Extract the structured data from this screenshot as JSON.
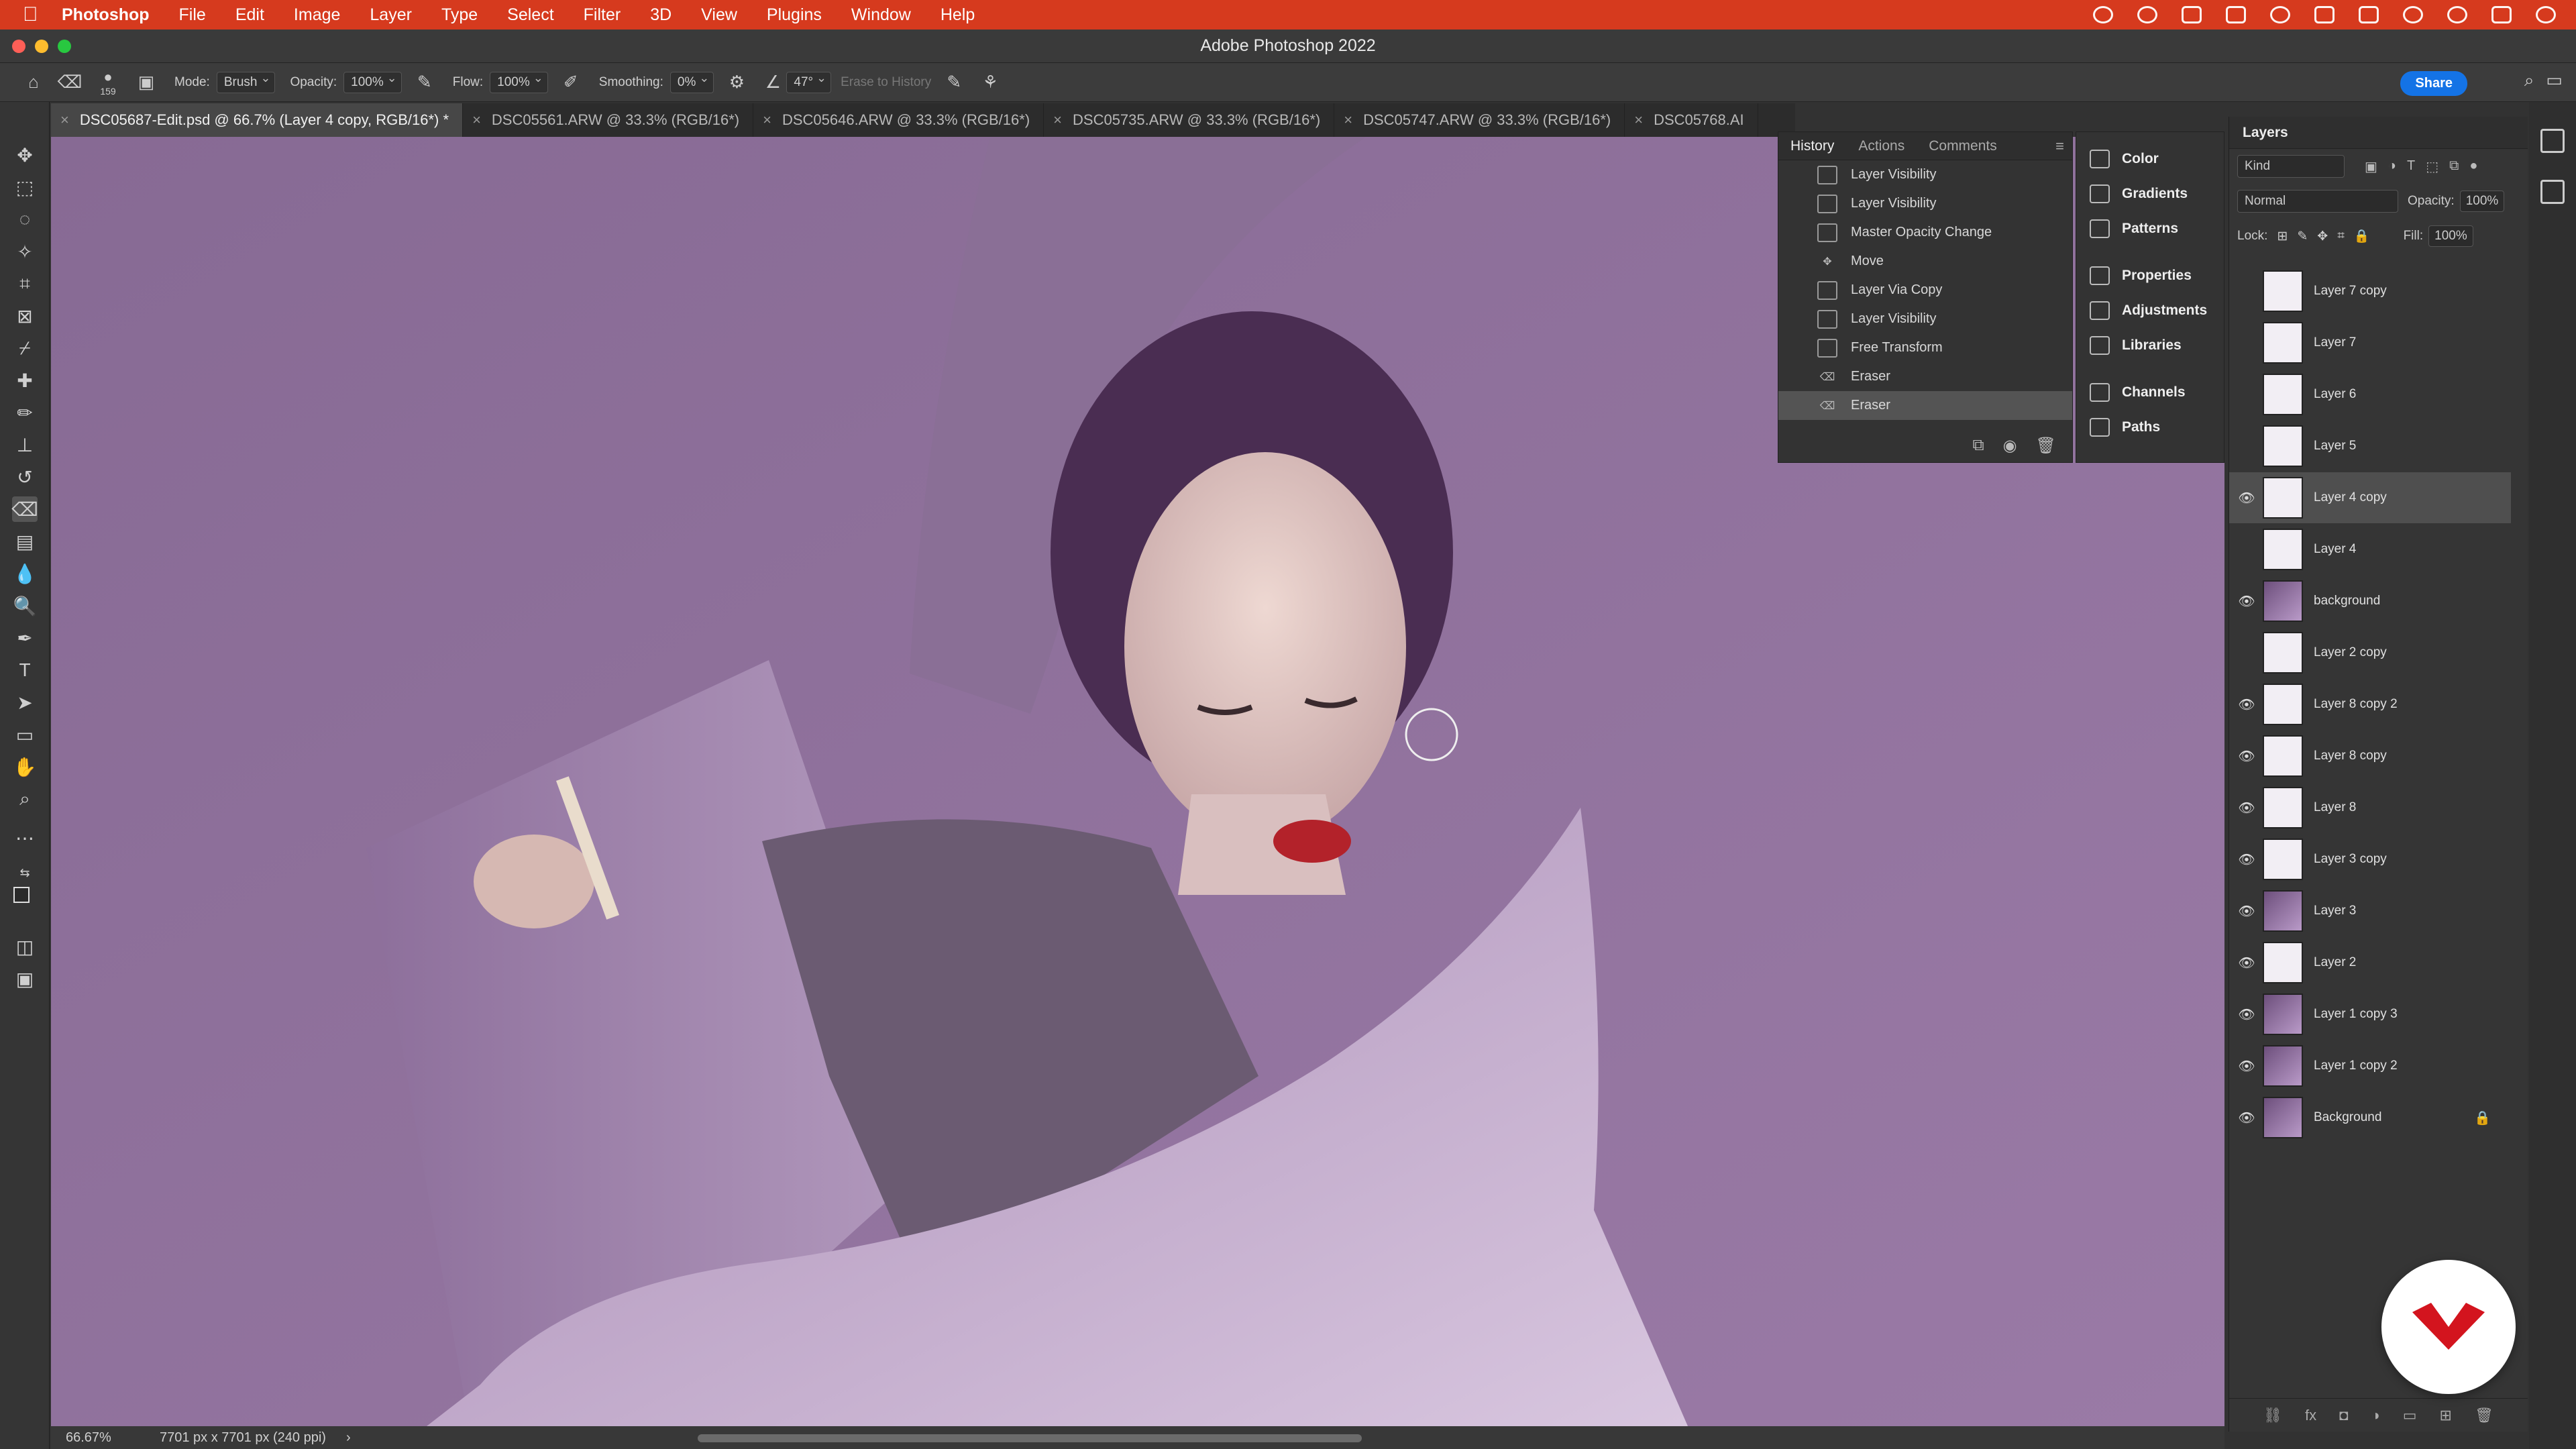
{
  "menubar": {
    "app": "Photoshop",
    "items": [
      "File",
      "Edit",
      "Image",
      "Layer",
      "Type",
      "Select",
      "Filter",
      "3D",
      "View",
      "Plugins",
      "Window",
      "Help"
    ]
  },
  "window": {
    "title": "Adobe Photoshop 2022"
  },
  "options": {
    "brush_size": "159",
    "mode_label": "Mode:",
    "mode_value": "Brush",
    "opacity_label": "Opacity:",
    "opacity_value": "100%",
    "flow_label": "Flow:",
    "flow_value": "100%",
    "smoothing_label": "Smoothing:",
    "smoothing_value": "0%",
    "angle_value": "47°",
    "erase_to_history": "Erase to History",
    "share_label": "Share"
  },
  "tabs": [
    {
      "label": "DSC05687-Edit.psd @ 66.7% (Layer 4 copy, RGB/16*) *",
      "active": true
    },
    {
      "label": "DSC05561.ARW @ 33.3% (RGB/16*)",
      "active": false
    },
    {
      "label": "DSC05646.ARW @ 33.3% (RGB/16*)",
      "active": false
    },
    {
      "label": "DSC05735.ARW @ 33.3% (RGB/16*)",
      "active": false
    },
    {
      "label": "DSC05747.ARW @ 33.3% (RGB/16*)",
      "active": false
    },
    {
      "label": "DSC05768.AI",
      "active": false
    }
  ],
  "history": {
    "tabs": [
      "History",
      "Actions",
      "Comments"
    ],
    "items": [
      {
        "label": "Layer Visibility",
        "icon": "doc-icon"
      },
      {
        "label": "Layer Visibility",
        "icon": "doc-icon"
      },
      {
        "label": "Master Opacity Change",
        "icon": "doc-icon"
      },
      {
        "label": "Move",
        "icon": "move-icon"
      },
      {
        "label": "Layer Via Copy",
        "icon": "doc-icon"
      },
      {
        "label": "Layer Visibility",
        "icon": "doc-icon"
      },
      {
        "label": "Free Transform",
        "icon": "doc-icon"
      },
      {
        "label": "Eraser",
        "icon": "eraser-icon"
      },
      {
        "label": "Eraser",
        "icon": "eraser-icon",
        "selected": true
      }
    ]
  },
  "dock": {
    "group1": [
      "Color",
      "Gradients",
      "Patterns"
    ],
    "group2": [
      "Properties",
      "Adjustments",
      "Libraries"
    ],
    "group3": [
      "Channels",
      "Paths"
    ]
  },
  "layers": {
    "title": "Layers",
    "kind": "Kind",
    "blend": "Normal",
    "opacity_label": "Opacity:",
    "opacity_value": "100%",
    "lock_label": "Lock:",
    "fill_label": "Fill:",
    "fill_value": "100%",
    "items": [
      {
        "name": "Layer 7 copy",
        "visible": false
      },
      {
        "name": "Layer 7",
        "visible": false
      },
      {
        "name": "Layer 6",
        "visible": false
      },
      {
        "name": "Layer 5",
        "visible": false
      },
      {
        "name": "Layer 4 copy",
        "visible": true,
        "selected": true
      },
      {
        "name": "Layer 4",
        "visible": false
      },
      {
        "name": "background",
        "visible": true
      },
      {
        "name": "Layer 2 copy",
        "visible": false
      },
      {
        "name": "Layer 8 copy 2",
        "visible": true
      },
      {
        "name": "Layer 8 copy",
        "visible": true
      },
      {
        "name": "Layer 8",
        "visible": true
      },
      {
        "name": "Layer 3 copy",
        "visible": true
      },
      {
        "name": "Layer 3",
        "visible": true
      },
      {
        "name": "Layer 2",
        "visible": true
      },
      {
        "name": "Layer 1 copy 3",
        "visible": true
      },
      {
        "name": "Layer 1 copy 2",
        "visible": true
      },
      {
        "name": "Background",
        "visible": true,
        "locked": true
      }
    ]
  },
  "status": {
    "zoom": "66.67%",
    "doc": "7701 px x 7701 px (240 ppi)"
  },
  "colors": {
    "menubar": "#d63a1e",
    "canvas_bg": "#8e6f9a",
    "paper": "#c9b3d2",
    "lips": "#b3222a",
    "accent": "#1473e6"
  }
}
